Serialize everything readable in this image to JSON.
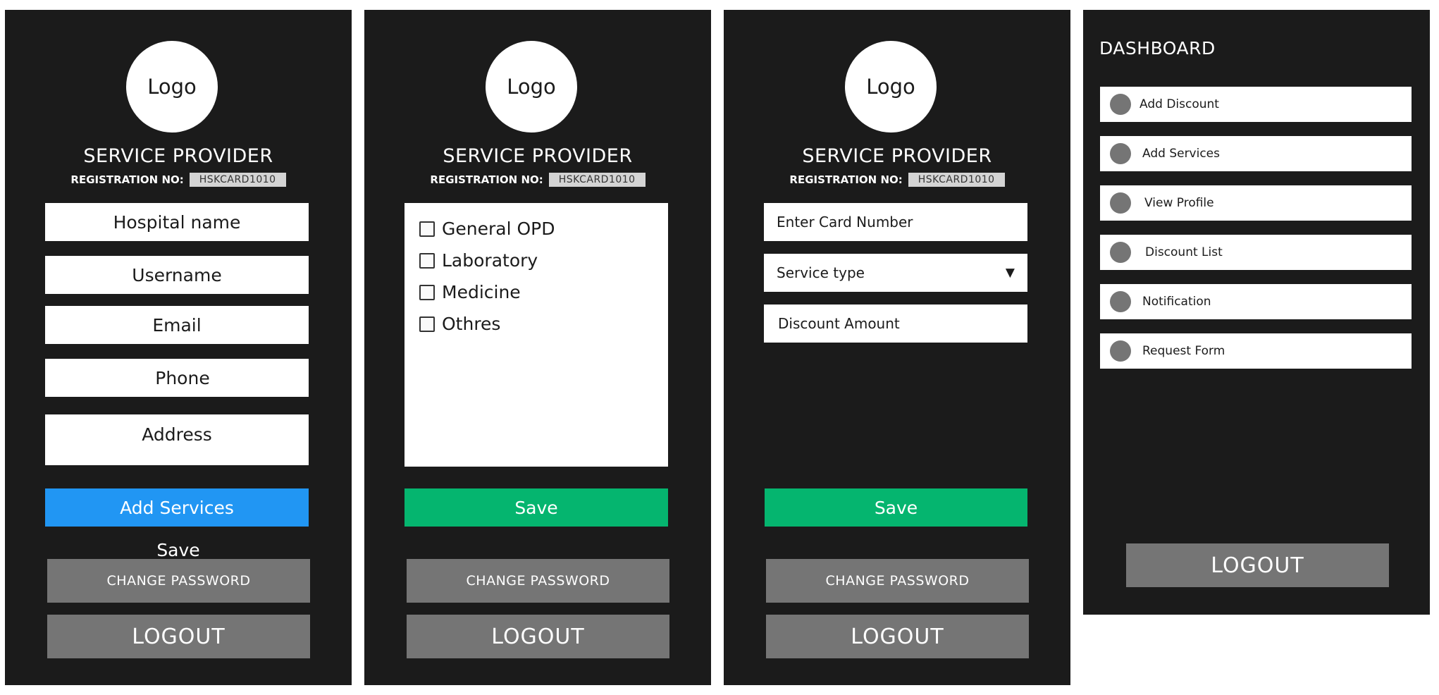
{
  "common": {
    "logo": "Logo",
    "title": "SERVICE PROVIDER",
    "reg_label": "REGISTRATION NO:",
    "reg_value": "HSKCARD1010",
    "change_password": "CHANGE PASSWORD",
    "logout": "LOGOUT"
  },
  "screen1": {
    "fields": [
      "Hospital name",
      "Username",
      "Email",
      "Phone",
      "Address"
    ],
    "add_services": "Add Services",
    "save": "Save"
  },
  "screen2": {
    "services": [
      "General OPD",
      "Laboratory",
      "Medicine",
      "Othres"
    ],
    "save": "Save"
  },
  "screen3": {
    "card_number_placeholder": "Enter Card Number",
    "service_type": "Service type",
    "dropdown_arrow": "▼",
    "discount_placeholder": "Discount Amount",
    "save": "Save"
  },
  "dashboard": {
    "title": "DASHBOARD",
    "items": [
      "Add Discount",
      "Add Services",
      "View Profile",
      "Discount List",
      "Notification",
      "Request Form"
    ],
    "logout": "LOGOUT"
  },
  "colors": {
    "panel_bg": "#1b1b1b",
    "primary_blue": "#2196f3",
    "save_green": "#05b56f",
    "gray_button": "#757575"
  }
}
